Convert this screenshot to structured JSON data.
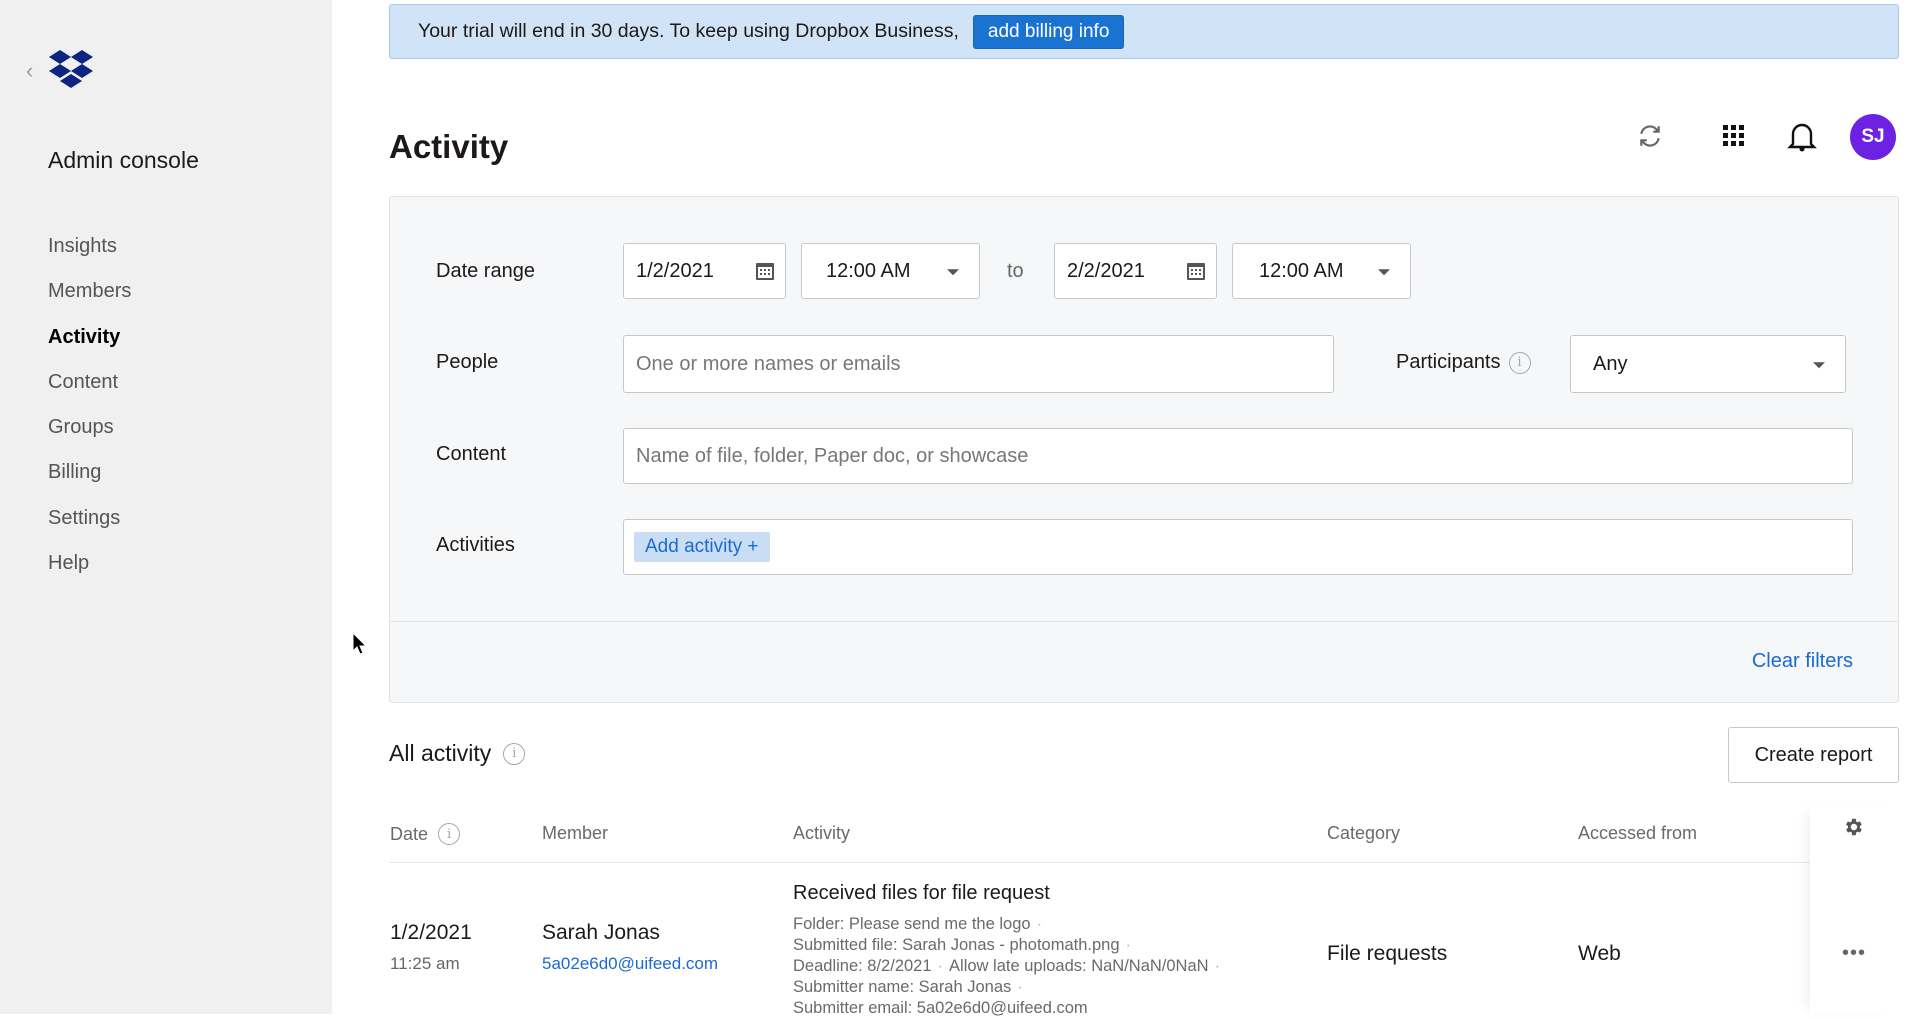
{
  "sidebar": {
    "back_icon": "chevron-left-icon",
    "logo": "dropbox-logo",
    "title": "Admin console",
    "items": [
      {
        "label": "Insights",
        "active": false
      },
      {
        "label": "Members",
        "active": false
      },
      {
        "label": "Activity",
        "active": true
      },
      {
        "label": "Content",
        "active": false
      },
      {
        "label": "Groups",
        "active": false
      },
      {
        "label": "Billing",
        "active": false
      },
      {
        "label": "Settings",
        "active": false
      },
      {
        "label": "Help",
        "active": false
      }
    ]
  },
  "banner": {
    "text": "Your trial will end in 30 days. To keep using Dropbox Business,",
    "button_label": "add billing info"
  },
  "header": {
    "title": "Activity",
    "icons": [
      "refresh-icon",
      "app-grid-icon",
      "bell-icon"
    ],
    "avatar_initials": "SJ",
    "avatar_color": "#6c22e0"
  },
  "filters": {
    "date_range_label": "Date range",
    "start_date": "1/2/2021",
    "start_time": "12:00 AM",
    "to_label": "to",
    "end_date": "2/2/2021",
    "end_time": "12:00 AM",
    "people_label": "People",
    "people_placeholder": "One or more names or emails",
    "participants_label": "Participants",
    "participants_value": "Any",
    "content_label": "Content",
    "content_placeholder": "Name of file, folder, Paper doc, or showcase",
    "activities_label": "Activities",
    "add_activity_label": "Add activity +",
    "clear_filters_label": "Clear filters"
  },
  "activity": {
    "section_title": "All activity",
    "create_report_label": "Create report",
    "columns": [
      "Date",
      "Member",
      "Activity",
      "Category",
      "Accessed from"
    ],
    "rows": [
      {
        "date": "1/2/2021",
        "time": "11:25 am",
        "member_name": "Sarah Jonas",
        "member_email": "5a02e6d0@uifeed.com",
        "activity_title": "Received files for file request",
        "details": {
          "folder": "Folder: Please send me the logo",
          "submitted_file": "Submitted file: Sarah Jonas - photomath.png",
          "deadline": "Deadline: 8/2/2021",
          "late_uploads": "Allow late uploads: NaN/NaN/0NaN",
          "submitter_name": "Submitter name: Sarah Jonas",
          "submitter_email": "Submitter email: 5a02e6d0@uifeed.com"
        },
        "category": "File requests",
        "accessed_from": "Web"
      }
    ]
  },
  "dot_separator": "·",
  "more_label": "•••"
}
